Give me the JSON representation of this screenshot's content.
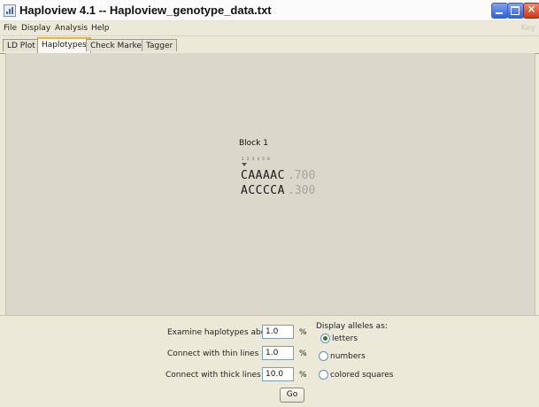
{
  "window": {
    "title": "Haploview 4.1 -- Haploview_genotype_data.txt",
    "key_label": "Key"
  },
  "menu": [
    "File",
    "Display",
    "Analysis",
    "Help"
  ],
  "tabs": [
    {
      "label": "LD Plot",
      "active": false
    },
    {
      "label": "Haplotypes",
      "active": true
    },
    {
      "label": "Check Markers",
      "active": false
    },
    {
      "label": "Tagger",
      "active": false
    }
  ],
  "haplotypes": {
    "block_label": "Block 1",
    "marker_ids": "1 2 3 4 5 6",
    "rows": [
      {
        "sequence": "CAAAAC",
        "frequency": ".700"
      },
      {
        "sequence": "ACCCCA",
        "frequency": ".300"
      }
    ]
  },
  "controls": {
    "examine_label": "Examine haplotypes above",
    "examine_value": "1.0",
    "thin_label": "Connect with thin lines if >",
    "thin_value": "1.0",
    "thick_label": "Connect with thick lines if >",
    "thick_value": "10.0",
    "percent": "%",
    "display_alleles_label": "Display alleles as:",
    "display_options": [
      {
        "label": "letters",
        "checked": true
      },
      {
        "label": "numbers",
        "checked": false
      },
      {
        "label": "colored squares",
        "checked": false
      }
    ],
    "go_label": "Go"
  }
}
